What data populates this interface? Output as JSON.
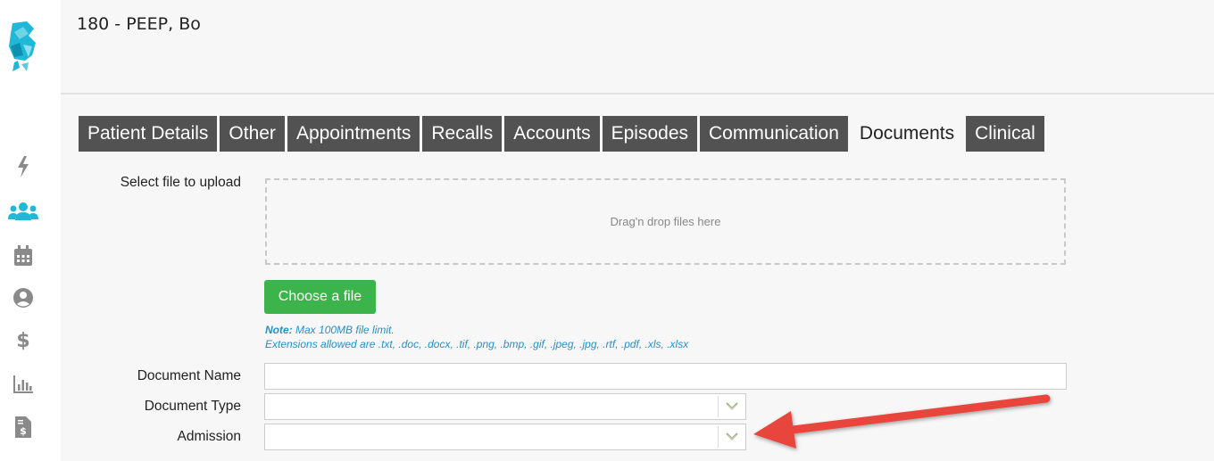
{
  "header": {
    "patient_title": "180 - PEEP, Bo"
  },
  "rail": {
    "icons": [
      "lightning-icon",
      "users-icon",
      "calendar-icon",
      "user-circle-icon",
      "dollar-icon",
      "bar-chart-icon",
      "invoice-icon"
    ],
    "active_color": "#1fb8d6",
    "icon_color": "#8a8a8a"
  },
  "tabs": [
    {
      "label": "Patient Details",
      "active": false
    },
    {
      "label": "Other",
      "active": false
    },
    {
      "label": "Appointments",
      "active": false
    },
    {
      "label": "Recalls",
      "active": false
    },
    {
      "label": "Accounts",
      "active": false
    },
    {
      "label": "Episodes",
      "active": false
    },
    {
      "label": "Communication",
      "active": false
    },
    {
      "label": "Documents",
      "active": true
    },
    {
      "label": "Clinical",
      "active": false
    }
  ],
  "upload": {
    "label": "Select file to upload",
    "dropzone_text": "Drag'n drop files here",
    "choose_button": "Choose a file",
    "note_prefix": "Note:",
    "note_text": "Max 100MB file limit.",
    "extensions_text": "Extensions allowed are .txt, .doc, .docx, .tif, .png, .bmp, .gif, .jpeg, .jpg, .rtf, .pdf, .xls, .xlsx"
  },
  "fields": {
    "document_name_label": "Document Name",
    "document_name_value": "",
    "document_type_label": "Document Type",
    "document_type_value": "",
    "admission_label": "Admission",
    "admission_value": ""
  },
  "colors": {
    "tab_bg": "#525252",
    "button_green": "#3cb44b",
    "note_blue": "#2a8fbd",
    "annotation_arrow": "#e8453c"
  }
}
